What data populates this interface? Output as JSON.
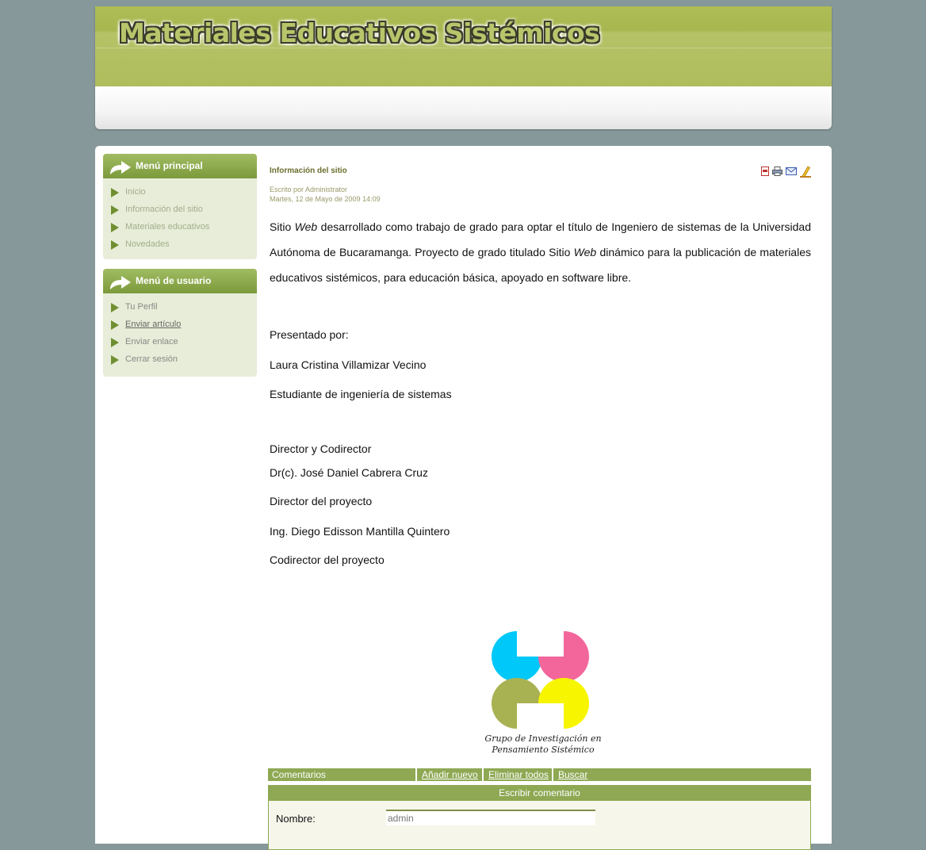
{
  "site": {
    "title": "Materiales Educativos Sistémicos"
  },
  "menu_principal": {
    "title": "Menú principal",
    "items": [
      {
        "label": "Inicio"
      },
      {
        "label": "Información del sitio"
      },
      {
        "label": "Materiales educativos"
      },
      {
        "label": "Novedades"
      }
    ]
  },
  "menu_usuario": {
    "title": "Menú de usuario",
    "items": [
      {
        "label": "Tu Perfil"
      },
      {
        "label": "Enviar artículo"
      },
      {
        "label": "Enviar enlace"
      },
      {
        "label": "Cerrar sesión"
      }
    ]
  },
  "article": {
    "title": "Información del sitio",
    "author": "Escrito por Administrator",
    "date": "Martes, 12 de Mayo de 2009 14:09",
    "icons": [
      "pdf-icon",
      "print-icon",
      "email-icon",
      "edit-icon"
    ],
    "intro_1": "Sitio ",
    "intro_web": "Web",
    "intro_2": " desarrollado como trabajo de grado para optar el título de Ingeniero de sistemas de la Universidad Autónoma de Bucaramanga. Proyecto de grado titulado Sitio ",
    "intro_web2": "Web",
    "intro_3": " dinámico para la publicación de materiales educativos sistémicos, para educación básica, apoyado en software libre.",
    "presented_by": "Presentado por:",
    "student_name": "Laura Cristina Villamizar Vecino",
    "student_role": "Estudiante de ingeniería de sistemas",
    "directors_heading": "Director y Codirector",
    "director_name": "Dr(c). José Daniel Cabrera Cruz",
    "director_role": "Director del proyecto",
    "codirector_name": "Ing. Diego Edisson Mantilla Quintero",
    "codirector_role": "Codirector del proyecto",
    "logo_caption_1": "Grupo de Investigación en",
    "logo_caption_2": "Pensamiento Sistémico"
  },
  "comments": {
    "bar_label": "Comentarios",
    "add_new": "Añadir nuevo",
    "delete_all": "Eliminar todos",
    "search": "Buscar",
    "form_title": "Escribir comentario",
    "name_label": "Nombre:",
    "name_value": "admin"
  },
  "colors": {
    "page_bg": "#86989a",
    "header_olive": "#abba58",
    "module_bg": "#e7edd8",
    "bar_green": "#8ea853",
    "logo_cyan": "#00c8f8",
    "logo_pink": "#f2669b",
    "logo_olive": "#a9b252",
    "logo_yellow": "#f7f500"
  }
}
